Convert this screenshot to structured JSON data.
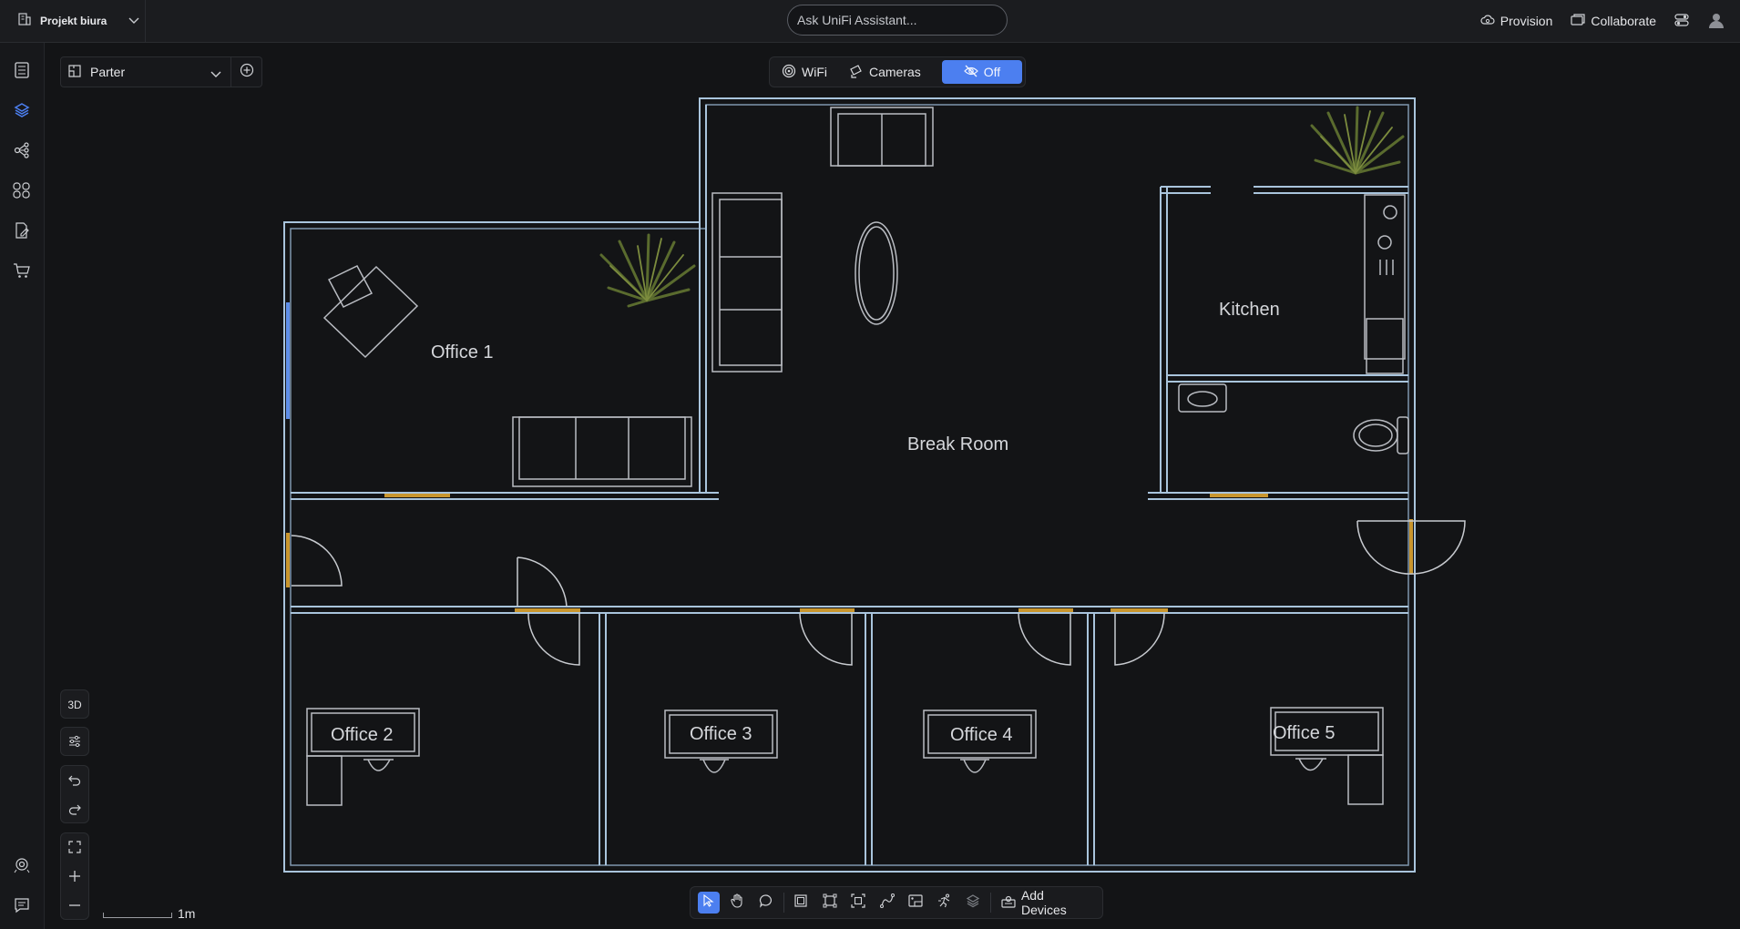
{
  "topbar": {
    "project_name": "Projekt biura",
    "assistant_placeholder": "Ask UniFi Assistant...",
    "provision_label": "Provision",
    "collaborate_label": "Collaborate"
  },
  "floor": {
    "selected": "Parter"
  },
  "view_toggle": {
    "wifi_label": "WiFi",
    "cameras_label": "Cameras",
    "off_label": "Off",
    "active": "Off"
  },
  "rooms": {
    "office1": "Office 1",
    "break_room": "Break Room",
    "kitchen": "Kitchen",
    "office2": "Office 2",
    "office3": "Office 3",
    "office4": "Office 4",
    "office5": "Office 5"
  },
  "left_tools": {
    "view_3d_label": "3D"
  },
  "scale": {
    "label": "1m"
  },
  "bottom_toolbar": {
    "add_devices_label": "Add Devices"
  },
  "colors": {
    "accent": "#4c7ff0",
    "wall": "#a9c4dc",
    "door": "#c9962e",
    "background": "#131416"
  }
}
